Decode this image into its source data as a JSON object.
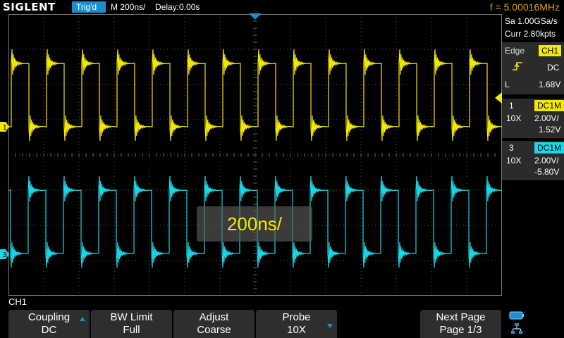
{
  "header": {
    "brand": "SIGLENT",
    "trigger_status": "Trig'd",
    "timebase": "M 200ns/",
    "delay": "Delay:0.00s",
    "frequency": "f = 5.00016MHz"
  },
  "side_panel": {
    "sample_rate": "Sa 1.00GSa/s",
    "memory_depth": "Curr 2.80kpts",
    "trigger": {
      "type": "Edge",
      "source": "CH1",
      "slope_icon": "rising-edge-icon",
      "coupling": "DC",
      "level_label": "L",
      "level": "1.68V"
    },
    "channel1": {
      "number": "1",
      "coupling_impedance": "DC1M",
      "probe": "10X",
      "volts_per_div": "2.00V/",
      "offset": "1.52V"
    },
    "channel3": {
      "number": "3",
      "coupling_impedance": "DC1M",
      "probe": "10X",
      "volts_per_div": "2.00V/",
      "offset": "-5.80V"
    }
  },
  "markers": {
    "ch1": "1",
    "ch3": "3"
  },
  "popup": {
    "text": "200ns/"
  },
  "menu": {
    "title": "CH1",
    "softkeys": [
      {
        "label": "Coupling",
        "value": "DC"
      },
      {
        "label": "BW Limit",
        "value": "Full"
      },
      {
        "label": "Adjust",
        "value": "Coarse"
      },
      {
        "label": "Probe",
        "value": "10X"
      },
      {
        "label": "Next Page",
        "value": "Page 1/3"
      }
    ]
  },
  "colors": {
    "ch1": "#f5e800",
    "ch3": "#1ad6e6",
    "accent": "#1a8fd0",
    "frequency_readout": "#e0a000",
    "grid": "#555555"
  },
  "icons": {
    "usb": "usb-icon",
    "network": "network-icon"
  }
}
